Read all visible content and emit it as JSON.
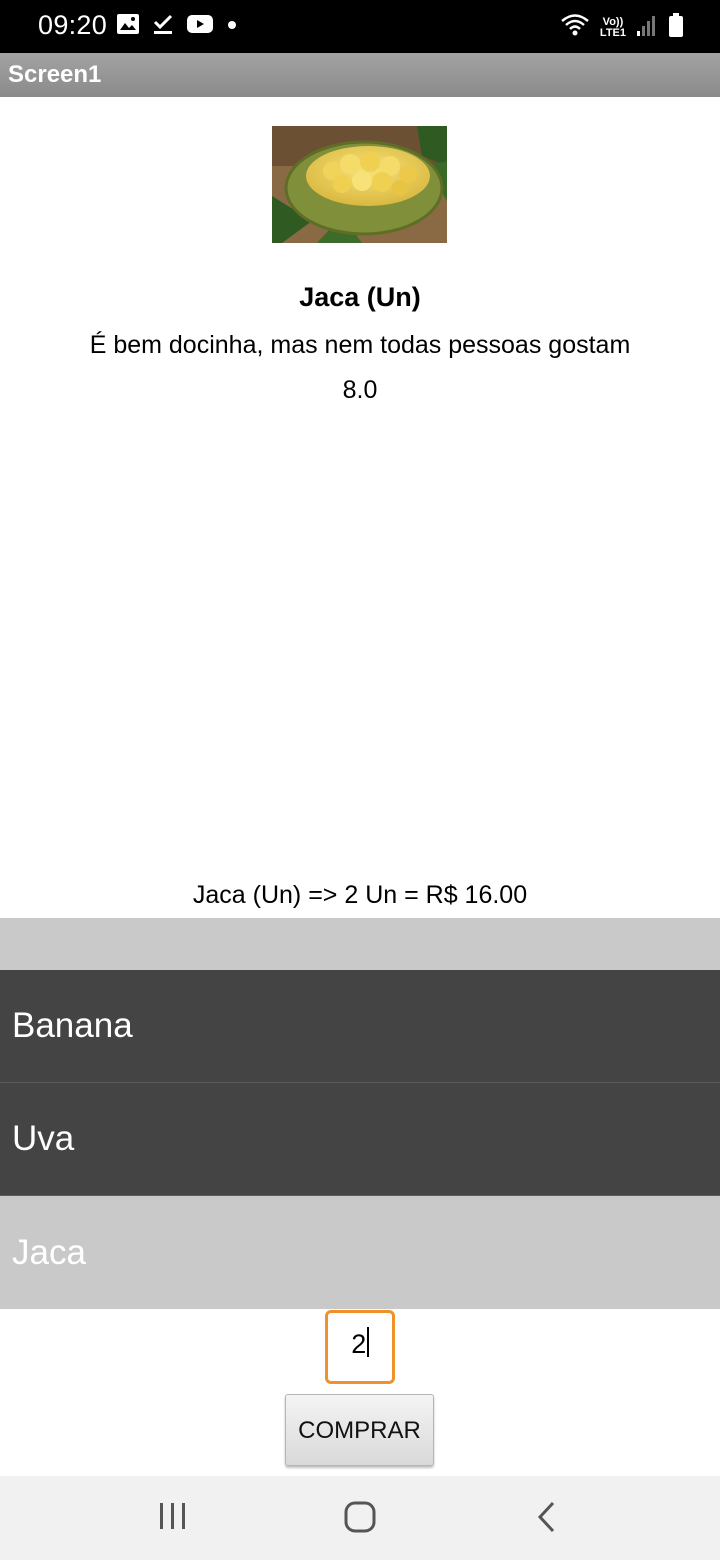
{
  "status_bar": {
    "time": "09:20",
    "left_icons": [
      "image-icon",
      "check-icon",
      "youtube-icon",
      "dot-icon"
    ],
    "right_icons": [
      "wifi-icon",
      "volte-lte-icon",
      "signal-icon",
      "battery-icon"
    ],
    "vo_label": "Vo))",
    "lte_label": "LTE1"
  },
  "title_bar": {
    "title": "Screen1"
  },
  "product": {
    "name": "Jaca (Un)",
    "description": "É bem docinha, mas nem todas pessoas gostam",
    "price": "8.0"
  },
  "order": {
    "summary": "Jaca (Un) => 2 Un = R$ 16.00"
  },
  "fruit_list": {
    "items": [
      {
        "label": "Banana",
        "selected": false
      },
      {
        "label": "Uva",
        "selected": false
      },
      {
        "label": "Jaca",
        "selected": true
      }
    ]
  },
  "quantity": {
    "value": "2"
  },
  "buy_button": {
    "label": "COMPRAR"
  },
  "colors": {
    "title_bar": "#939393",
    "list_item_bg": "#444444",
    "list_selected_bg": "#c9c9c9",
    "input_border": "#f0922c"
  }
}
